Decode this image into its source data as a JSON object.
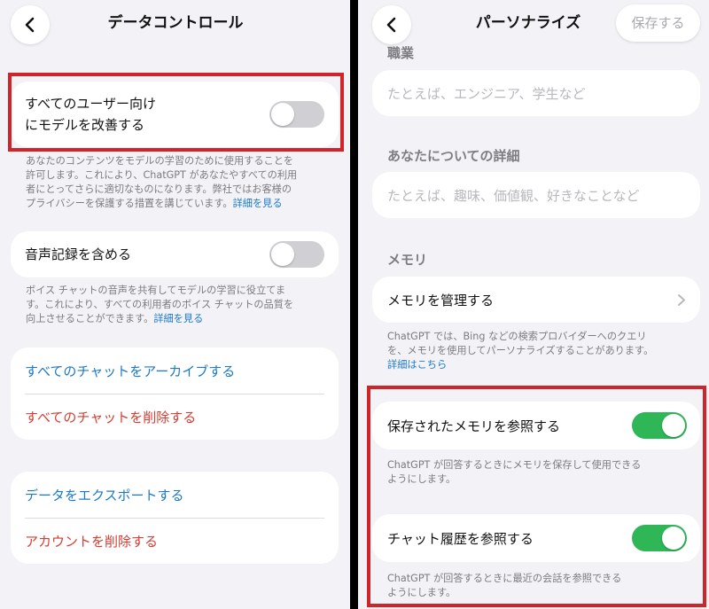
{
  "left": {
    "title": "データコントロール",
    "improve_model": {
      "label_line1": "すべてのユーザー向け",
      "label_line2": "にモデルを改善する",
      "toggle_on": false,
      "note_lines": [
        "あなたのコンテンツをモデルの学習のために使用することを",
        "許可します。これにより、ChatGPT があなたやすべての利用",
        "者にとってさらに適切なものになります。弊社ではお客様の",
        "プライバシーを保護する措置を講じています。"
      ],
      "note_link": "詳細を見る"
    },
    "voice": {
      "label": "音声記録を含める",
      "toggle_on": false,
      "note_lines": [
        "ボイス チャットの音声を共有してモデルの学習に役立てま",
        "す。これにより、すべての利用者のボイス チャットの品質を",
        "向上させることができます。"
      ],
      "note_link": "詳細を見る"
    },
    "archive_all": "すべてのチャットをアーカイブする",
    "delete_all": "すべてのチャットを削除する",
    "export_data": "データをエクスポートする",
    "delete_account": "アカウントを削除する"
  },
  "right": {
    "title": "パーソナライズ",
    "save_label": "保存する",
    "occupation_header": "職業",
    "occupation_placeholder": "たとえば、エンジニア、学生など",
    "about_header": "あなたについての詳細",
    "about_placeholder": "たとえば、趣味、価値観、好きなことなど",
    "memory_header": "メモリ",
    "manage_memory": "メモリを管理する",
    "memory_note_lines": [
      "ChatGPT では、Bing などの検索プロバイダーへのクエリ",
      "を、メモリを使用してパーソナライズすることがあります。"
    ],
    "memory_note_link": "詳細はこちら",
    "saved_memory": {
      "label": "保存されたメモリを参照する",
      "toggle_on": true,
      "note_lines": [
        "ChatGPT が回答するときにメモリを保存して使用できる",
        "ようにします。"
      ]
    },
    "chat_history": {
      "label": "チャット履歴を参照する",
      "toggle_on": true,
      "note_lines": [
        "ChatGPT が回答するときに最近の会話を参照できる",
        "ようにします。"
      ]
    }
  },
  "colors": {
    "highlight": "#d0242b",
    "toggle_on": "#2fb657",
    "toggle_off": "#d0d0d4",
    "link": "#1b79c9",
    "destructive": "#d63c31"
  }
}
